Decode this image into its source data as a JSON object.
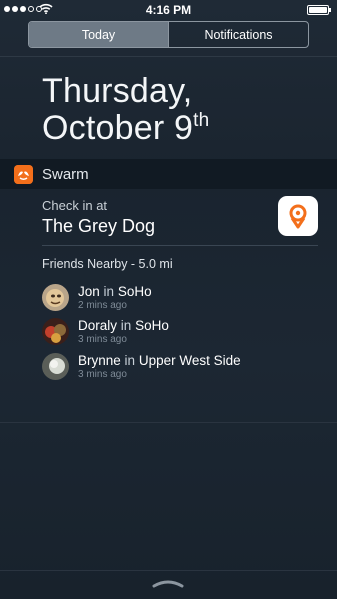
{
  "status_bar": {
    "time": "4:16 PM",
    "signal_bars_filled": 3,
    "signal_bars_total": 5,
    "battery_level": 1.0
  },
  "segmented": {
    "tabs": [
      {
        "label": "Today",
        "active": true
      },
      {
        "label": "Notifications",
        "active": false
      }
    ]
  },
  "date": {
    "line1": "Thursday,",
    "line2": "October 9",
    "suffix": "th"
  },
  "widget": {
    "app_name": "Swarm",
    "checkin_label": "Check in at",
    "venue": "The Grey Dog",
    "friends_heading": "Friends Nearby - 5.0 mi",
    "friends": [
      {
        "name": "Jon",
        "connector": "in",
        "place": "SoHo",
        "time": "2 mins ago"
      },
      {
        "name": "Doraly",
        "connector": "in",
        "place": "SoHo",
        "time": "3 mins ago"
      },
      {
        "name": "Brynne",
        "connector": "in",
        "place": "Upper West Side",
        "time": "3 mins ago"
      }
    ]
  },
  "colors": {
    "swarm_orange": "#f36f1b",
    "background": "#1c2733",
    "header_band": "#111a23"
  },
  "icons": {
    "signal": "signal-dots-icon",
    "wifi": "wifi-icon",
    "battery": "battery-icon",
    "app": "swarm-app-icon",
    "checkin": "swarm-checkin-icon",
    "grabber": "chevron-up-icon"
  }
}
